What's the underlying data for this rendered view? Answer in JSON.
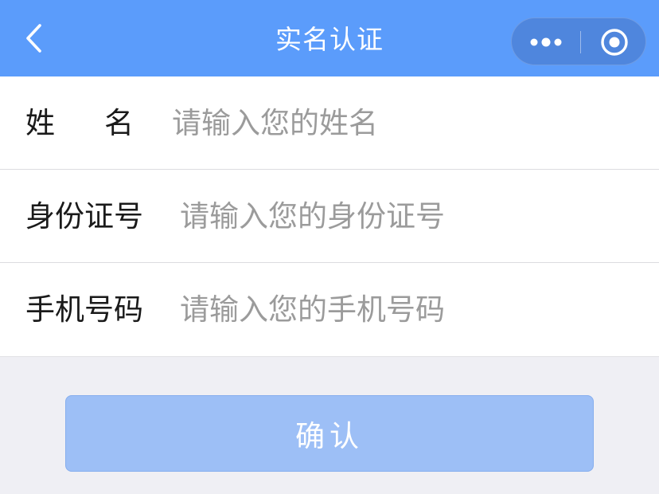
{
  "navbar": {
    "title": "实名认证",
    "background": "#5b9cfb",
    "back_icon": "chevron-left-icon",
    "more_icon": "more-dots-icon",
    "close_icon": "target-close-icon"
  },
  "form": {
    "name": {
      "label": "姓名",
      "placeholder": "请输入您的姓名"
    },
    "id_number": {
      "label": "身份证号",
      "placeholder": "请输入您的身份证号"
    },
    "phone": {
      "label": "手机号码",
      "placeholder": "请输入您的手机号码"
    }
  },
  "confirm_button": {
    "label": "确认",
    "background": "#9dbff6"
  }
}
